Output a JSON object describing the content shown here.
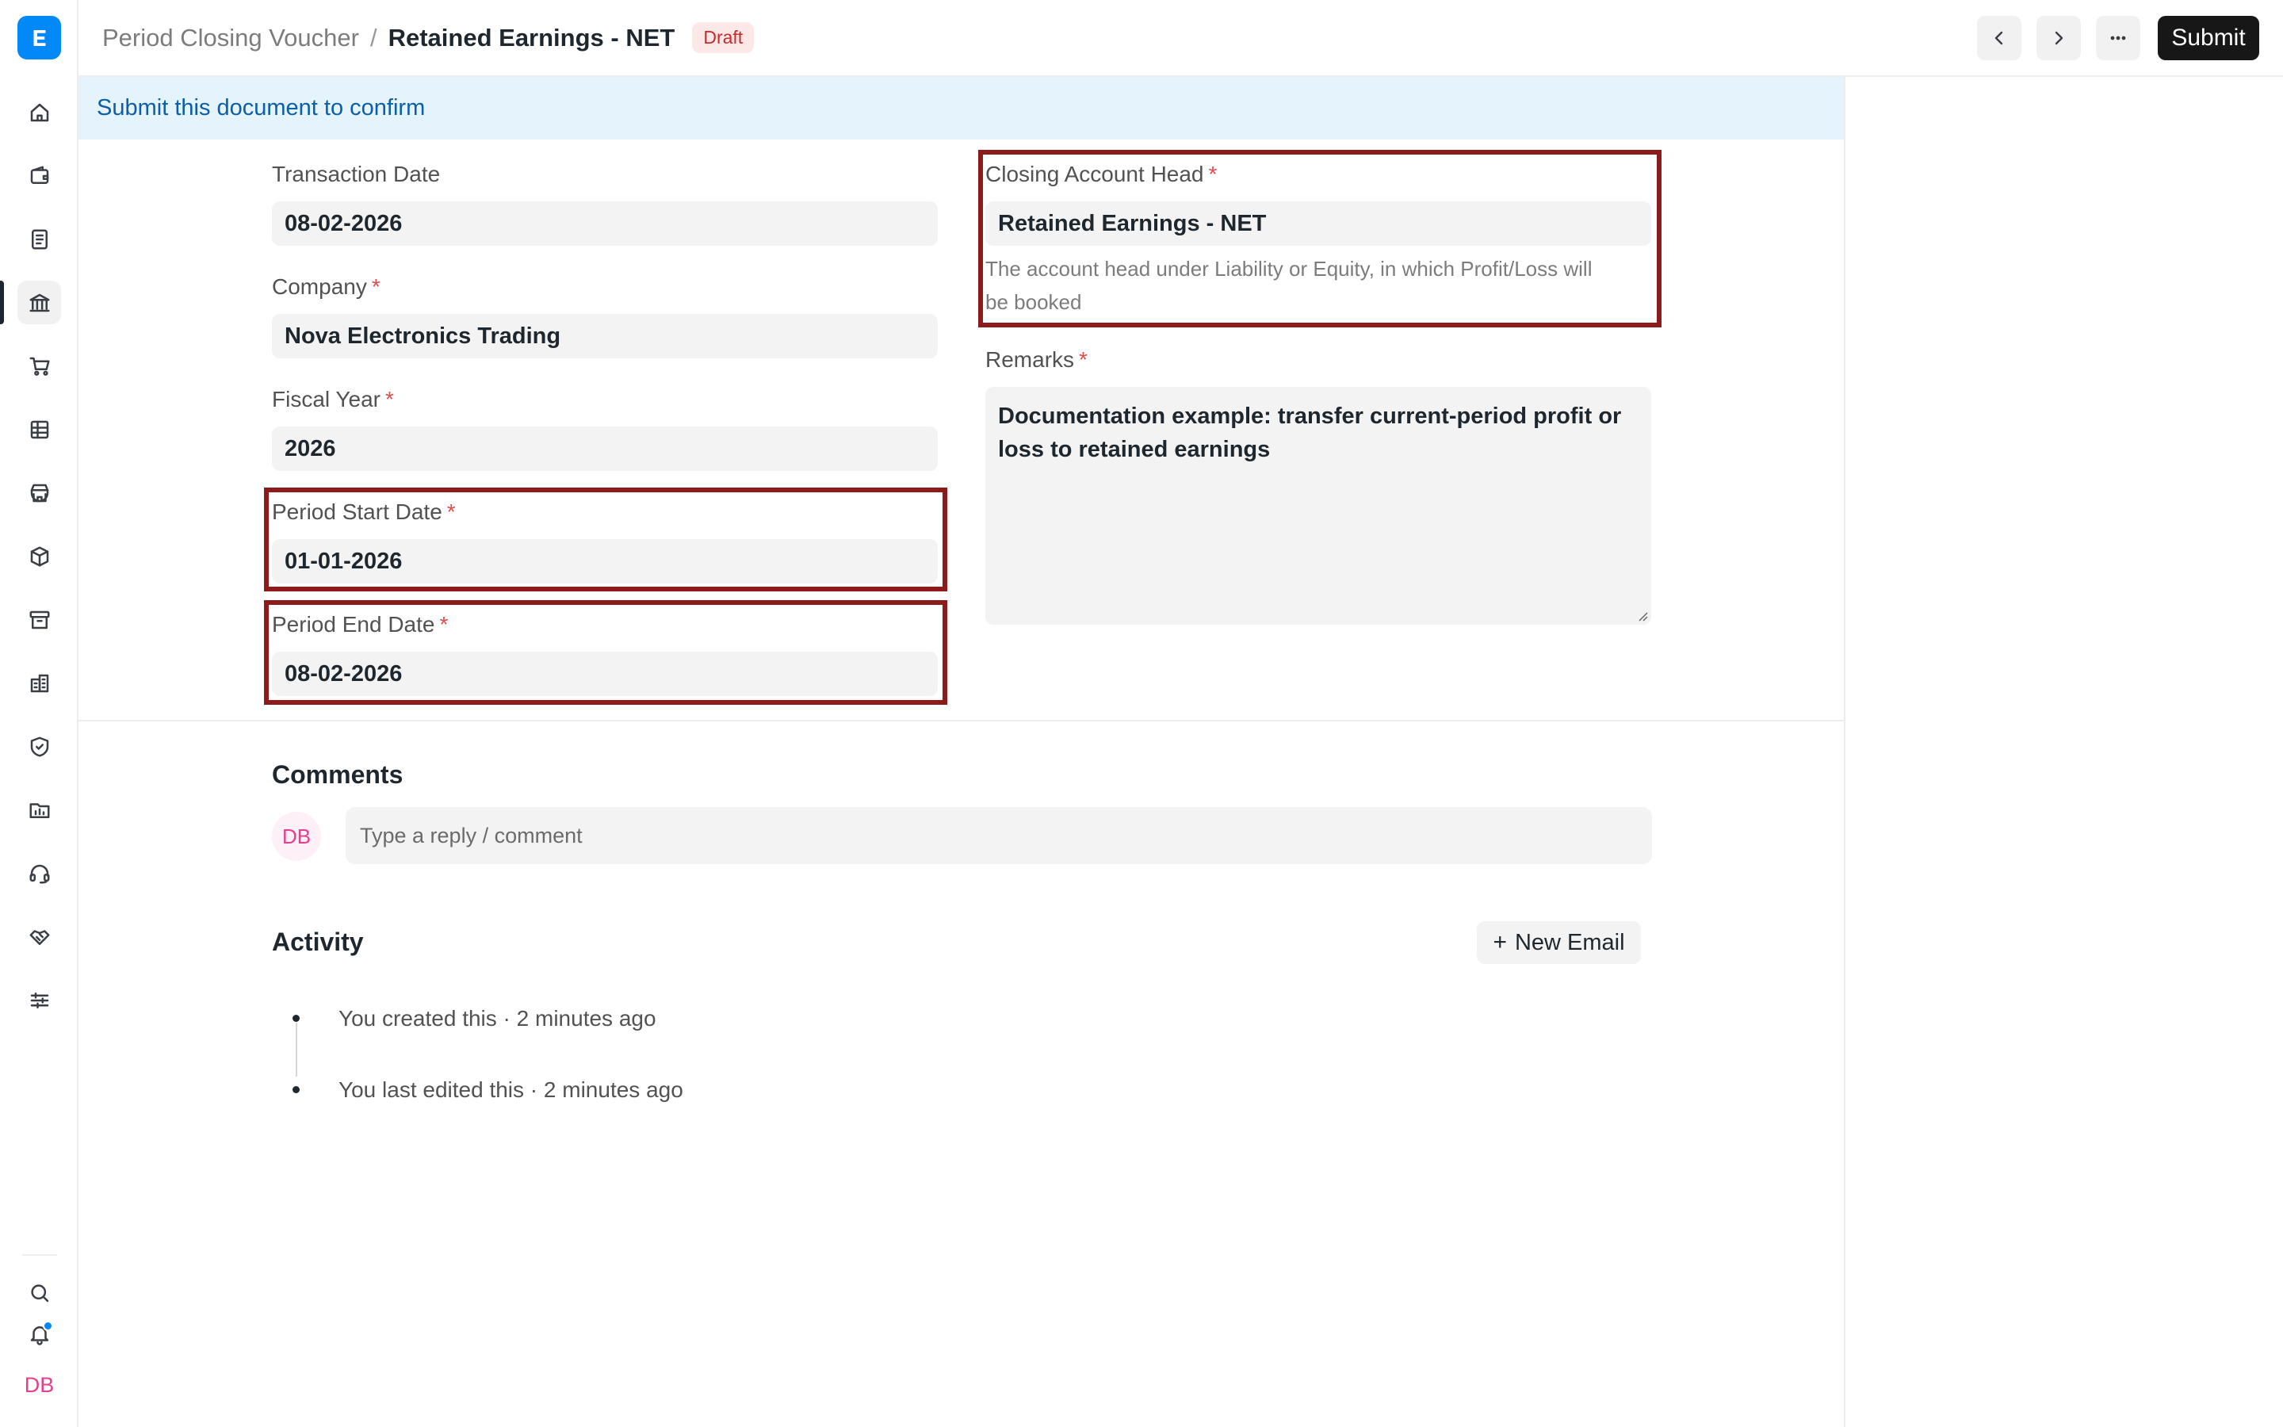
{
  "header": {
    "breadcrumb_parent": "Period Closing Voucher",
    "breadcrumb_sep": "/",
    "title": "Retained Earnings - NET",
    "status_badge": "Draft",
    "submit_label": "Submit"
  },
  "banner": {
    "message": "Submit this document to confirm"
  },
  "form": {
    "transaction_date": {
      "label": "Transaction Date",
      "value": "08-02-2026"
    },
    "company": {
      "label": "Company",
      "required": "*",
      "value": "Nova Electronics Trading"
    },
    "fiscal_year": {
      "label": "Fiscal Year",
      "required": "*",
      "value": "2026"
    },
    "period_start_date": {
      "label": "Period Start Date",
      "required": "*",
      "value": "01-01-2026"
    },
    "period_end_date": {
      "label": "Period End Date",
      "required": "*",
      "value": "08-02-2026"
    },
    "closing_account_head": {
      "label": "Closing Account Head",
      "required": "*",
      "value": "Retained Earnings - NET",
      "description_line1": "The account head under Liability or Equity, in which Profit/Loss will",
      "description_line2": "be booked"
    },
    "remarks": {
      "label": "Remarks",
      "required": "*",
      "line1": "Documentation example: transfer current-period profit or",
      "line2": "loss to retained earnings"
    }
  },
  "comments": {
    "title": "Comments",
    "avatar_initials": "DB",
    "placeholder": "Type a reply / comment"
  },
  "activity": {
    "title": "Activity",
    "new_email_plus": "+",
    "new_email_label": "New Email",
    "items": [
      {
        "text": "You created this · 2 minutes ago"
      },
      {
        "text": "You last edited this · 2 minutes ago"
      }
    ]
  },
  "sidebar": {
    "avatar_initials": "DB",
    "items": [
      {
        "icon": "home-icon"
      },
      {
        "icon": "wallet-icon"
      },
      {
        "icon": "invoice-icon"
      },
      {
        "icon": "bank-icon",
        "active": true
      },
      {
        "icon": "cart-icon"
      },
      {
        "icon": "table-icon"
      },
      {
        "icon": "store-icon"
      },
      {
        "icon": "package-icon"
      },
      {
        "icon": "archive-icon"
      },
      {
        "icon": "building-icon"
      },
      {
        "icon": "shield-check-icon"
      },
      {
        "icon": "chart-folder-icon"
      },
      {
        "icon": "headset-icon"
      },
      {
        "icon": "handshake-icon"
      },
      {
        "icon": "sliders-icon"
      }
    ]
  },
  "colors": {
    "brand": "#0289f7",
    "highlight": "#8e1b1b",
    "banner_bg": "#e5f3fd",
    "draft_badge": "#cc2929"
  }
}
